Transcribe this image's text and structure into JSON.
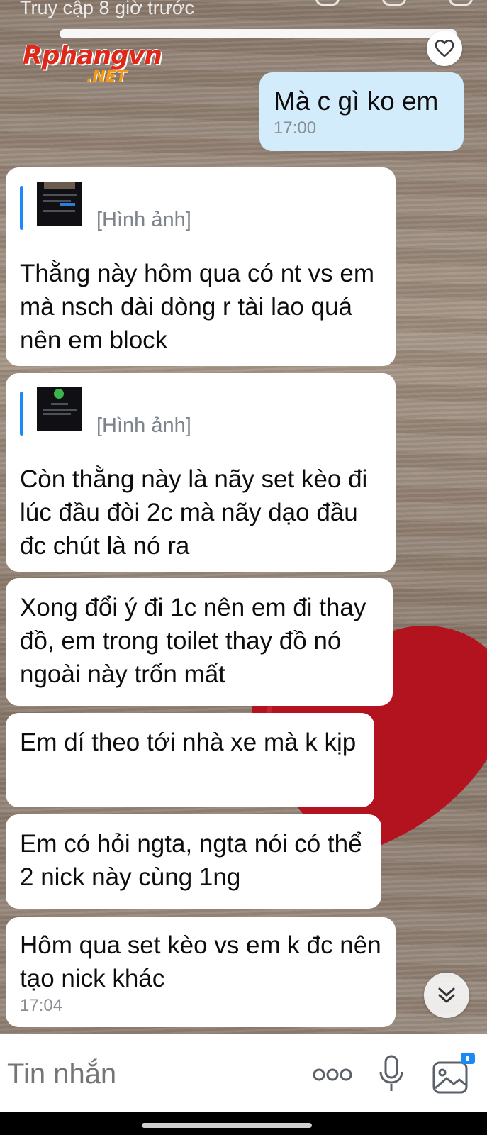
{
  "header": {
    "status_text": "Truy cập 8 giờ trước",
    "watermark_main": "Rphangvn",
    "watermark_sub": ".NET"
  },
  "icons": {
    "heart": "heart-outline-icon",
    "scroll_down": "double-chevron-down-icon",
    "more": "more-dots-icon",
    "mic": "microphone-icon",
    "gallery": "image-gallery-icon"
  },
  "colors": {
    "sent_bubble": "#d2ecfb",
    "received_bubble": "#ffffff",
    "quote_bar": "#1a8af5",
    "heart_red": "#b3121f"
  },
  "messages": [
    {
      "type": "sent",
      "text": "Mà c gì ko em",
      "time": "17:00"
    },
    {
      "type": "received",
      "quote_label": "[Hình ảnh]",
      "text": "Thằng này hôm qua có nt vs em mà nsch dài dòng r tài lao quá nên em block"
    },
    {
      "type": "received",
      "quote_label": "[Hình ảnh]",
      "text": "Còn thằng này là nãy set kèo đi lúc đầu đòi 2c mà nãy dạo đầu đc chút là nó ra"
    },
    {
      "type": "received",
      "text": "Xong đổi ý đi 1c nên em đi thay đồ, em trong toilet thay đồ nó ngoài này trốn mất"
    },
    {
      "type": "received",
      "text": "Em dí theo tới nhà xe mà k kịp"
    },
    {
      "type": "received",
      "text": "Em có hỏi ngta, ngta nói có thể 2 nick này cùng 1ng"
    },
    {
      "type": "received",
      "text": "Hôm qua set kèo vs em k đc nên tạo nick khác",
      "time": "17:04"
    }
  ],
  "composer": {
    "placeholder": "Tin nhắn"
  }
}
